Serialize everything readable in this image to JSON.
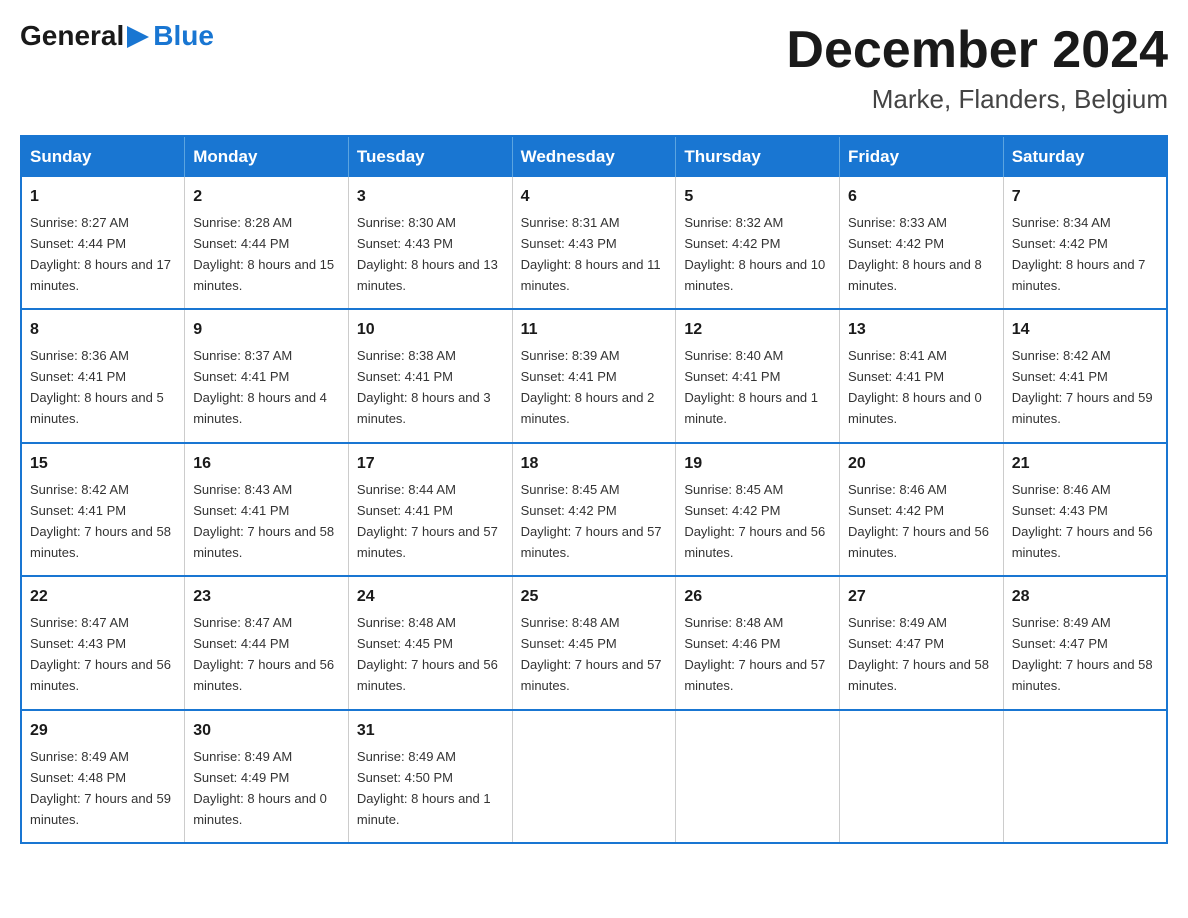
{
  "header": {
    "logo_general": "General",
    "logo_blue": "Blue",
    "month_title": "December 2024",
    "location": "Marke, Flanders, Belgium"
  },
  "days_of_week": [
    "Sunday",
    "Monday",
    "Tuesday",
    "Wednesday",
    "Thursday",
    "Friday",
    "Saturday"
  ],
  "weeks": [
    [
      {
        "day": "1",
        "sunrise": "8:27 AM",
        "sunset": "4:44 PM",
        "daylight": "8 hours and 17 minutes."
      },
      {
        "day": "2",
        "sunrise": "8:28 AM",
        "sunset": "4:44 PM",
        "daylight": "8 hours and 15 minutes."
      },
      {
        "day": "3",
        "sunrise": "8:30 AM",
        "sunset": "4:43 PM",
        "daylight": "8 hours and 13 minutes."
      },
      {
        "day": "4",
        "sunrise": "8:31 AM",
        "sunset": "4:43 PM",
        "daylight": "8 hours and 11 minutes."
      },
      {
        "day": "5",
        "sunrise": "8:32 AM",
        "sunset": "4:42 PM",
        "daylight": "8 hours and 10 minutes."
      },
      {
        "day": "6",
        "sunrise": "8:33 AM",
        "sunset": "4:42 PM",
        "daylight": "8 hours and 8 minutes."
      },
      {
        "day": "7",
        "sunrise": "8:34 AM",
        "sunset": "4:42 PM",
        "daylight": "8 hours and 7 minutes."
      }
    ],
    [
      {
        "day": "8",
        "sunrise": "8:36 AM",
        "sunset": "4:41 PM",
        "daylight": "8 hours and 5 minutes."
      },
      {
        "day": "9",
        "sunrise": "8:37 AM",
        "sunset": "4:41 PM",
        "daylight": "8 hours and 4 minutes."
      },
      {
        "day": "10",
        "sunrise": "8:38 AM",
        "sunset": "4:41 PM",
        "daylight": "8 hours and 3 minutes."
      },
      {
        "day": "11",
        "sunrise": "8:39 AM",
        "sunset": "4:41 PM",
        "daylight": "8 hours and 2 minutes."
      },
      {
        "day": "12",
        "sunrise": "8:40 AM",
        "sunset": "4:41 PM",
        "daylight": "8 hours and 1 minute."
      },
      {
        "day": "13",
        "sunrise": "8:41 AM",
        "sunset": "4:41 PM",
        "daylight": "8 hours and 0 minutes."
      },
      {
        "day": "14",
        "sunrise": "8:42 AM",
        "sunset": "4:41 PM",
        "daylight": "7 hours and 59 minutes."
      }
    ],
    [
      {
        "day": "15",
        "sunrise": "8:42 AM",
        "sunset": "4:41 PM",
        "daylight": "7 hours and 58 minutes."
      },
      {
        "day": "16",
        "sunrise": "8:43 AM",
        "sunset": "4:41 PM",
        "daylight": "7 hours and 58 minutes."
      },
      {
        "day": "17",
        "sunrise": "8:44 AM",
        "sunset": "4:41 PM",
        "daylight": "7 hours and 57 minutes."
      },
      {
        "day": "18",
        "sunrise": "8:45 AM",
        "sunset": "4:42 PM",
        "daylight": "7 hours and 57 minutes."
      },
      {
        "day": "19",
        "sunrise": "8:45 AM",
        "sunset": "4:42 PM",
        "daylight": "7 hours and 56 minutes."
      },
      {
        "day": "20",
        "sunrise": "8:46 AM",
        "sunset": "4:42 PM",
        "daylight": "7 hours and 56 minutes."
      },
      {
        "day": "21",
        "sunrise": "8:46 AM",
        "sunset": "4:43 PM",
        "daylight": "7 hours and 56 minutes."
      }
    ],
    [
      {
        "day": "22",
        "sunrise": "8:47 AM",
        "sunset": "4:43 PM",
        "daylight": "7 hours and 56 minutes."
      },
      {
        "day": "23",
        "sunrise": "8:47 AM",
        "sunset": "4:44 PM",
        "daylight": "7 hours and 56 minutes."
      },
      {
        "day": "24",
        "sunrise": "8:48 AM",
        "sunset": "4:45 PM",
        "daylight": "7 hours and 56 minutes."
      },
      {
        "day": "25",
        "sunrise": "8:48 AM",
        "sunset": "4:45 PM",
        "daylight": "7 hours and 57 minutes."
      },
      {
        "day": "26",
        "sunrise": "8:48 AM",
        "sunset": "4:46 PM",
        "daylight": "7 hours and 57 minutes."
      },
      {
        "day": "27",
        "sunrise": "8:49 AM",
        "sunset": "4:47 PM",
        "daylight": "7 hours and 58 minutes."
      },
      {
        "day": "28",
        "sunrise": "8:49 AM",
        "sunset": "4:47 PM",
        "daylight": "7 hours and 58 minutes."
      }
    ],
    [
      {
        "day": "29",
        "sunrise": "8:49 AM",
        "sunset": "4:48 PM",
        "daylight": "7 hours and 59 minutes."
      },
      {
        "day": "30",
        "sunrise": "8:49 AM",
        "sunset": "4:49 PM",
        "daylight": "8 hours and 0 minutes."
      },
      {
        "day": "31",
        "sunrise": "8:49 AM",
        "sunset": "4:50 PM",
        "daylight": "8 hours and 1 minute."
      },
      null,
      null,
      null,
      null
    ]
  ],
  "labels": {
    "sunrise": "Sunrise:",
    "sunset": "Sunset:",
    "daylight": "Daylight:"
  }
}
